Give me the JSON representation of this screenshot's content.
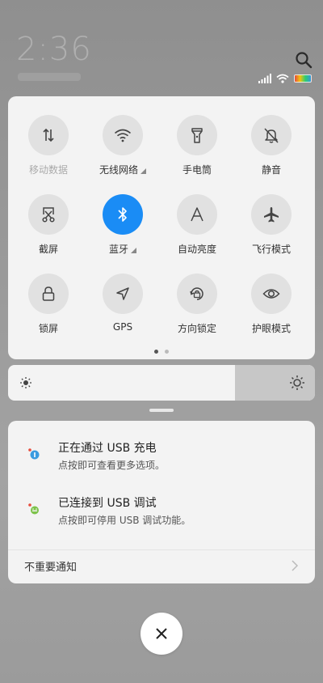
{
  "status": {
    "clock": "2:36",
    "search_icon": "search-icon",
    "signal_icon": "cell-signal-icon",
    "wifi_icon": "wifi-icon",
    "battery_icon": "battery-icon"
  },
  "quick_settings": {
    "tiles": [
      {
        "label": "移动数据",
        "icon": "mobile-data-icon",
        "active": false,
        "dim": true,
        "expand": false
      },
      {
        "label": "无线网络",
        "icon": "wifi-icon",
        "active": false,
        "dim": false,
        "expand": true
      },
      {
        "label": "手电筒",
        "icon": "flashlight-icon",
        "active": false,
        "dim": false,
        "expand": false
      },
      {
        "label": "静音",
        "icon": "mute-bell-icon",
        "active": false,
        "dim": false,
        "expand": false
      },
      {
        "label": "截屏",
        "icon": "screenshot-icon",
        "active": false,
        "dim": false,
        "expand": false
      },
      {
        "label": "蓝牙",
        "icon": "bluetooth-icon",
        "active": true,
        "dim": false,
        "expand": true
      },
      {
        "label": "自动亮度",
        "icon": "auto-brightness-icon",
        "active": false,
        "dim": false,
        "expand": false
      },
      {
        "label": "飞行模式",
        "icon": "airplane-icon",
        "active": false,
        "dim": false,
        "expand": false
      },
      {
        "label": "锁屏",
        "icon": "lock-icon",
        "active": false,
        "dim": false,
        "expand": false
      },
      {
        "label": "GPS",
        "icon": "gps-icon",
        "active": false,
        "dim": false,
        "expand": false
      },
      {
        "label": "方向锁定",
        "icon": "rotation-lock-icon",
        "active": false,
        "dim": false,
        "expand": false
      },
      {
        "label": "护眼模式",
        "icon": "eye-icon",
        "active": false,
        "dim": false,
        "expand": false
      }
    ],
    "page_indicator": {
      "pages": 2,
      "current": 1
    }
  },
  "brightness": {
    "level": 0.74
  },
  "notifications": {
    "items": [
      {
        "title": "正在通过 USB 充电",
        "text": "点按即可查看更多选项。",
        "icon": "usb-charging-icon"
      },
      {
        "title": "已连接到 USB 调试",
        "text": "点按即可停用 USB 调试功能。",
        "icon": "android-debug-icon"
      }
    ],
    "unimportant_label": "不重要通知"
  },
  "colors": {
    "accent": "#1a8cf5",
    "panel": "#f3f3f3",
    "tile_bg": "#e1e1e1"
  }
}
